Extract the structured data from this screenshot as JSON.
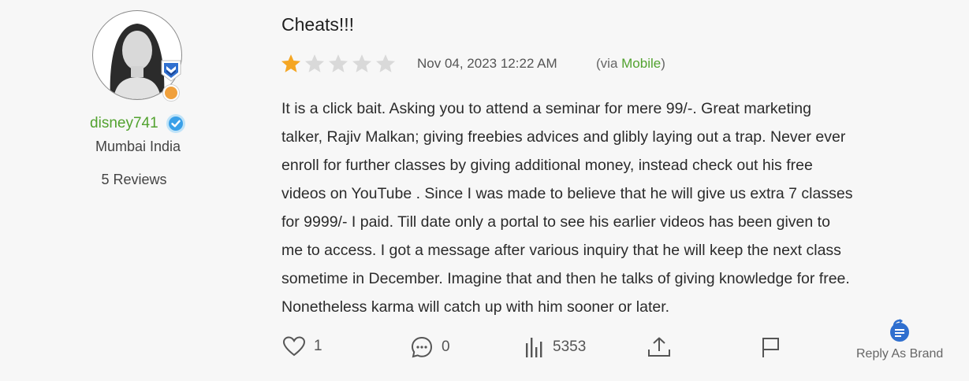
{
  "reviewer": {
    "username": "disney741",
    "location": "Mumbai India",
    "reviews_count": "5 Reviews",
    "avatar_icon": "user-avatar",
    "badge_icon": "shield-chevron-badge",
    "verified_icon": "verified-check-icon",
    "online_status_color": "#f0a03c"
  },
  "review": {
    "title": "Cheats!!!",
    "rating": 1,
    "rating_max": 5,
    "date": "Nov 04, 2023 12:22 AM",
    "via_prefix": "(via ",
    "via_source": "Mobile",
    "via_suffix": ")",
    "body_lines": [
      "It is a click bait. Asking you to attend a seminar for mere 99/-. Great marketing",
      "talker, Rajiv Malkan; giving freebies advices and glibly laying out a trap. Never ever",
      "enroll for further classes by giving additional money, instead check out his free",
      "videos on YouTube . Since I was made to believe that he will give us extra 7 classes",
      "for 9999/- I paid. Till date only a portal to see his earlier videos has been given to",
      "me to access. I got a message after various inquiry that he will keep the next class",
      "sometime in December. Imagine that and then he talks of giving knowledge for free.",
      "Nonetheless karma will catch up with him sooner or later."
    ]
  },
  "actions": {
    "likes": "1",
    "comments": "0",
    "views": "5353",
    "reply_as_brand": "Reply As Brand"
  },
  "colors": {
    "star_filled": "#f5a623",
    "star_empty": "#d9d9d9",
    "accent_green": "#52a22f",
    "verified_blue": "#3aa0e8",
    "brand_blue": "#2f6fcf"
  }
}
